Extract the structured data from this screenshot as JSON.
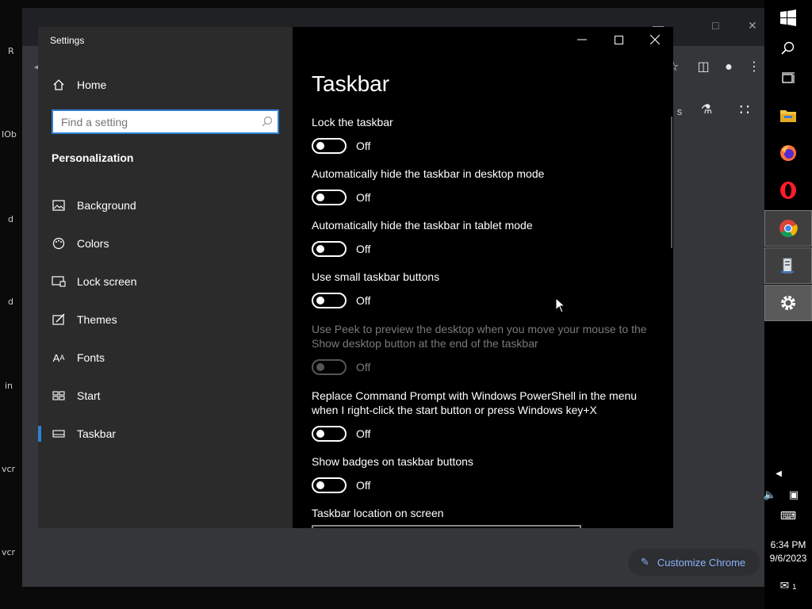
{
  "settings_window": {
    "title": "Settings",
    "home_label": "Home",
    "search_placeholder": "Find a setting",
    "section": "Personalization",
    "nav": [
      {
        "label": "Background",
        "icon": "picture-icon"
      },
      {
        "label": "Colors",
        "icon": "palette-icon"
      },
      {
        "label": "Lock screen",
        "icon": "lock-screen-icon"
      },
      {
        "label": "Themes",
        "icon": "brush-icon"
      },
      {
        "label": "Fonts",
        "icon": "font-icon"
      },
      {
        "label": "Start",
        "icon": "start-tiles-icon"
      },
      {
        "label": "Taskbar",
        "icon": "taskbar-icon",
        "active": true
      }
    ],
    "page_title": "Taskbar",
    "settings": [
      {
        "label": "Lock the taskbar",
        "state": "Off",
        "enabled": true
      },
      {
        "label": "Automatically hide the taskbar in desktop mode",
        "state": "Off",
        "enabled": true
      },
      {
        "label": "Automatically hide the taskbar in tablet mode",
        "state": "Off",
        "enabled": true
      },
      {
        "label": "Use small taskbar buttons",
        "state": "Off",
        "enabled": true
      },
      {
        "label": "Use Peek to preview the desktop when you move your mouse to the Show desktop button at the end of the taskbar",
        "state": "Off",
        "enabled": false
      },
      {
        "label": "Replace Command Prompt with Windows PowerShell in the menu when I right-click the start button or press Windows key+X",
        "state": "Off",
        "enabled": true
      },
      {
        "label": "Show badges on taskbar buttons",
        "state": "Off",
        "enabled": true
      }
    ],
    "location_label": "Taskbar location on screen"
  },
  "chrome": {
    "customize_label": "Customize Chrome",
    "partial_text": "s"
  },
  "desktop_labels": [
    "R",
    "IOb",
    "d",
    "d",
    "in",
    "vcr",
    "vcr"
  ],
  "taskbar": {
    "apps": [
      "windows-start-icon",
      "search-icon",
      "task-view-icon",
      "file-explorer-icon",
      "firefox-icon",
      "opera-icon",
      "chrome-icon",
      "server-manager-icon",
      "settings-gear-icon"
    ],
    "time": "6:34 PM",
    "date": "9/6/2023",
    "notification_count": "1"
  },
  "colors": {
    "accent": "#2f7fd7",
    "sidebar_bg": "#2b2b2b",
    "main_bg": "#000000",
    "chrome_link": "#8ab4f8"
  }
}
